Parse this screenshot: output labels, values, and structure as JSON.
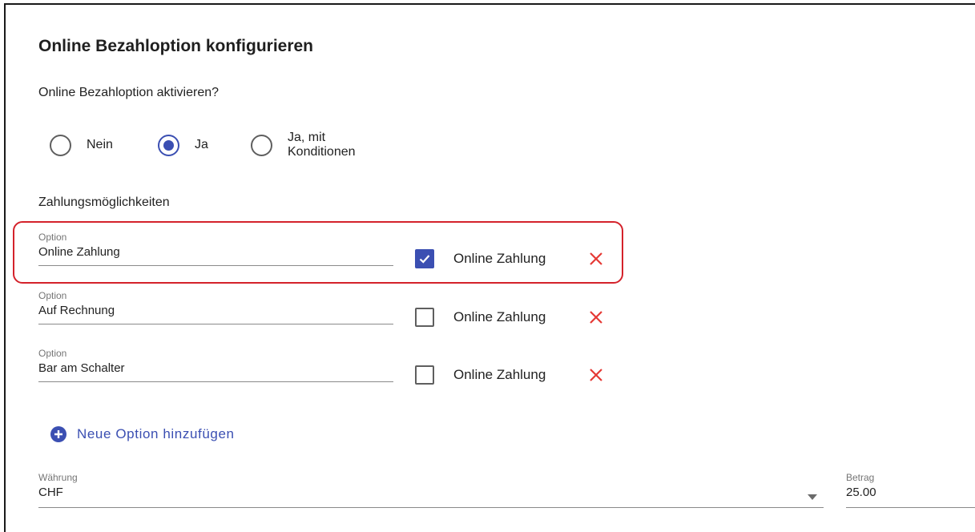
{
  "title": "Online Bezahloption konfigurieren",
  "question": "Online Bezahloption aktivieren?",
  "radios": [
    {
      "label": "Nein",
      "checked": false
    },
    {
      "label": "Ja",
      "checked": true
    },
    {
      "label": "Ja, mit Konditionen",
      "checked": false
    }
  ],
  "section_label": "Zahlungsmöglichkeiten",
  "options": [
    {
      "field_label": "Option",
      "value": "Online Zahlung",
      "checkbox_label": "Online Zahlung",
      "checked": true,
      "highlighted": true
    },
    {
      "field_label": "Option",
      "value": "Auf Rechnung",
      "checkbox_label": "Online Zahlung",
      "checked": false,
      "highlighted": false
    },
    {
      "field_label": "Option",
      "value": "Bar am Schalter",
      "checkbox_label": "Online Zahlung",
      "checked": false,
      "highlighted": false
    }
  ],
  "add_option_label": "Neue Option hinzufügen",
  "currency": {
    "label": "Währung",
    "value": "CHF"
  },
  "amount": {
    "label": "Betrag",
    "value": "25.00"
  },
  "icons": {
    "add": "plus-circle-icon",
    "delete": "close-icon",
    "dropdown": "caret-down-icon",
    "check": "check-icon"
  },
  "colors": {
    "accent": "#3b4fb2",
    "delete": "#e53935",
    "highlight": "#d4222b"
  }
}
